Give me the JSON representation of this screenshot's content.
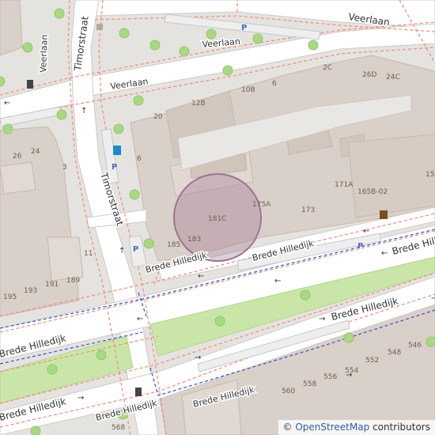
{
  "map": {
    "streets": {
      "veerlaan_top": "Veerlaan",
      "veerlaan_mid": "Veerlaan",
      "veerlaan_left": "Veerlaan",
      "veerlaan_west": "Veerlaan",
      "timorstraat_north": "Timorstraat",
      "timorstraat_south": "Timorstraat",
      "brede_hilledijk_1": "Brede Hilledijk",
      "brede_hilledijk_2": "Brede Hilledijk",
      "brede_hilledijk_3": "Brede Hilledijk",
      "brede_hilledijk_4": "Brede Hilledijk",
      "brede_hilledijk_5": "Brede Hilledijk",
      "brede_hilledijk_6": "Brede Hilledijk",
      "brede_hilledijk_7": "Brede Hilledijk",
      "brede_hilledijk_8": "Brede Hilledijk"
    },
    "house_numbers": [
      "2C",
      "26D",
      "24C",
      "10B",
      "6",
      "12B",
      "20",
      "6",
      "171A",
      "165B-02",
      "15",
      "175A",
      "173",
      "181C",
      "183",
      "185",
      "26",
      "24",
      "3",
      "11",
      "189",
      "191",
      "193",
      "195",
      "548",
      "546",
      "552",
      "554",
      "556",
      "558",
      "560",
      "568"
    ],
    "parking_label": "P",
    "highlight_color": "#a0748f",
    "attribution": {
      "symbol": "©",
      "link_text": "OpenStreetMap",
      "suffix": "contributors"
    }
  }
}
